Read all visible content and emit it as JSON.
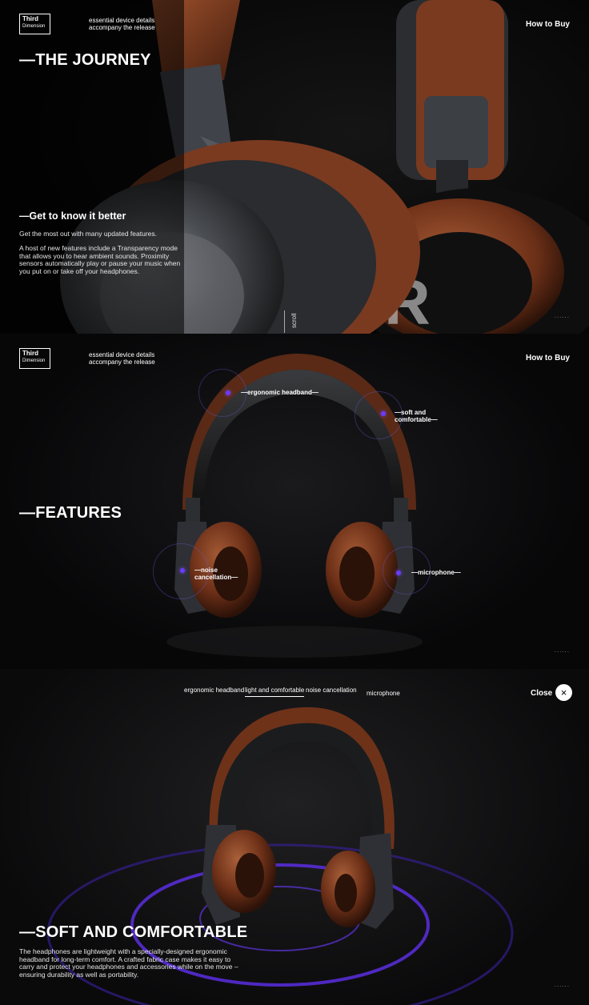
{
  "brand": {
    "line1": "Third",
    "line2": "Dimension"
  },
  "tagline": "essential device details accompany the release",
  "how_to_buy": "How to Buy",
  "panel1": {
    "title": "—THE JOURNEY",
    "subtitle": "—Get to know it better",
    "intro": "Get the most out with many updated features.",
    "body": "A host of new features include a Transparency mode that allows you to hear ambient sounds. Proximity sensors automatically play or pause your music when you put on or take off your headphones.",
    "scroll": "scroll",
    "dots": "......"
  },
  "panel2": {
    "title": "—FEATURES",
    "hotspots": {
      "headband": "—ergonomic headband—",
      "soft": "—soft and comfortable—",
      "noise": "—noise cancellation—",
      "mic": "—microphone—"
    },
    "dots": "......"
  },
  "panel3": {
    "nav": [
      "ergonomic headband",
      "light and comfortable",
      "noise cancellation",
      "microphone"
    ],
    "close": "Close",
    "close_icon": "×",
    "title": "—SOFT AND COMFORTABLE",
    "body": "The headphones are lightweight with a specially-designed ergonomic headband for long-term comfort. A crafted fabric case makes it easy to carry and protect your headphones and accessories while on the move – ensuring durability as well as portability.",
    "dots": "......"
  },
  "colors": {
    "accent": "#6a3bff",
    "leather": "#7a3a20",
    "metal": "#3a3d42"
  }
}
